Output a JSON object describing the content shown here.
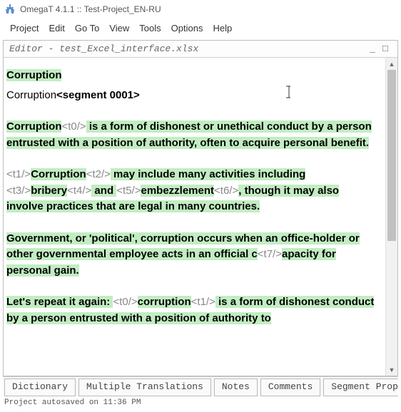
{
  "window": {
    "title": "OmegaT 4.1.1 :: Test-Project_EN-RU"
  },
  "menu": {
    "items": [
      "Project",
      "Edit",
      "Go To",
      "View",
      "Tools",
      "Options",
      "Help"
    ]
  },
  "editor": {
    "header": "Editor - test_Excel_interface.xlsx",
    "min_btn": "_",
    "max_btn": "□"
  },
  "segments": {
    "seg1_source": "Corruption",
    "seg1_target_prefix": "Corruption",
    "seg1_marker": "<segment 0001>",
    "seg2_pre": "Corruption",
    "seg2_tag0": "<t0/>",
    "seg2_post": " is a form of dishonest or unethical conduct by a person entrusted with a position of authority, often to acquire personal benefit.",
    "seg3_tag1": "<t1/>",
    "seg3_a": "Corruption",
    "seg3_tag2": "<t2/>",
    "seg3_b": " may include many activities including ",
    "seg3_tag3": "<t3/>",
    "seg3_c": "bribery",
    "seg3_tag4": "<t4/>",
    "seg3_d": " and ",
    "seg3_tag5": "<t5/>",
    "seg3_e": "embezzlement",
    "seg3_tag6": "<t6/>",
    "seg3_f": ", though it may also involve practices that are legal in many countries.",
    "seg4_a": "Government, or 'political', corruption occurs when an office-holder or other governmental employee acts in an official c",
    "seg4_tag7": "<t7/>",
    "seg4_b": "apacity for personal gain.",
    "seg5_a": "Let's repeat it again: ",
    "seg5_tag0": "<t0/>",
    "seg5_b": "corruption",
    "seg5_tag1": "<t1/>",
    "seg5_c": " is a form of dishonest conduct by a person entrusted with a position of authority to "
  },
  "tabs": {
    "items": [
      "Dictionary",
      "Multiple Translations",
      "Notes",
      "Comments",
      "Segment Proper"
    ]
  },
  "status": {
    "text": "Project autosaved on 11:36 PM"
  }
}
